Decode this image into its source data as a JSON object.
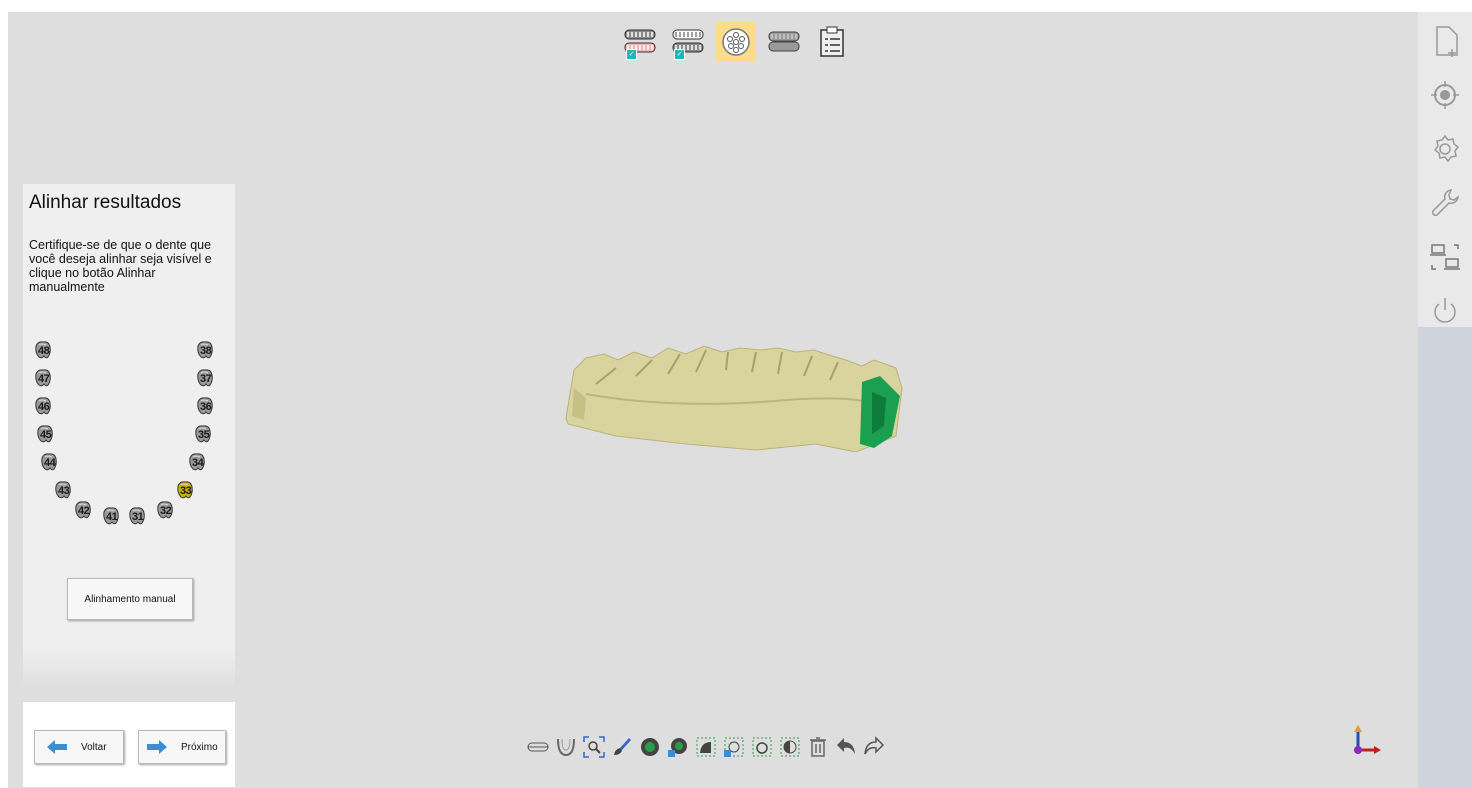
{
  "workflow_steps": [
    {
      "icon": "upper-jaw-scan-icon",
      "completed": true
    },
    {
      "icon": "lower-jaw-scan-icon",
      "completed": true
    },
    {
      "icon": "alignment-points-icon",
      "completed": false,
      "active": true
    },
    {
      "icon": "bite-scan-icon",
      "completed": false
    },
    {
      "icon": "report-clipboard-icon",
      "completed": false
    }
  ],
  "right_toolbar": [
    {
      "icon": "new-file-icon"
    },
    {
      "icon": "target-icon"
    },
    {
      "icon": "gear-icon"
    },
    {
      "icon": "wrench-icon"
    },
    {
      "icon": "screenshot-capture-icon"
    },
    {
      "icon": "power-icon"
    }
  ],
  "panel": {
    "title": "Alinhar resultados",
    "instruction": "Certifique-se de que o dente que você deseja alinhar seja visível e clique no botão Alinhar manualmente",
    "manual_button": "Alinhamento manual",
    "teeth": [
      {
        "num": "48",
        "selected": false
      },
      {
        "num": "47",
        "selected": false
      },
      {
        "num": "46",
        "selected": false
      },
      {
        "num": "45",
        "selected": false
      },
      {
        "num": "44",
        "selected": false
      },
      {
        "num": "43",
        "selected": false
      },
      {
        "num": "42",
        "selected": false
      },
      {
        "num": "41",
        "selected": false
      },
      {
        "num": "31",
        "selected": false
      },
      {
        "num": "32",
        "selected": false
      },
      {
        "num": "33",
        "selected": true
      },
      {
        "num": "34",
        "selected": false
      },
      {
        "num": "35",
        "selected": false
      },
      {
        "num": "36",
        "selected": false
      },
      {
        "num": "37",
        "selected": false
      },
      {
        "num": "38",
        "selected": false
      }
    ]
  },
  "nav": {
    "back": "Voltar",
    "next": "Próximo"
  },
  "bottom_toolbar": [
    "single-jaw-view-icon",
    "arch-view-icon",
    "zoom-fit-icon",
    "brush-select-icon",
    "select-region-icon",
    "deselect-region-icon",
    "lasso-select-icon",
    "lasso-deselect-icon",
    "rect-select-icon",
    "invert-selection-icon",
    "delete-icon",
    "undo-icon",
    "redo-icon"
  ],
  "colors": {
    "accent_active": "#fbdc8a",
    "check": "#21b6b6",
    "model": "#d9d49e",
    "highlight": "#1aa050",
    "selected_tooth": "#c8b200"
  }
}
